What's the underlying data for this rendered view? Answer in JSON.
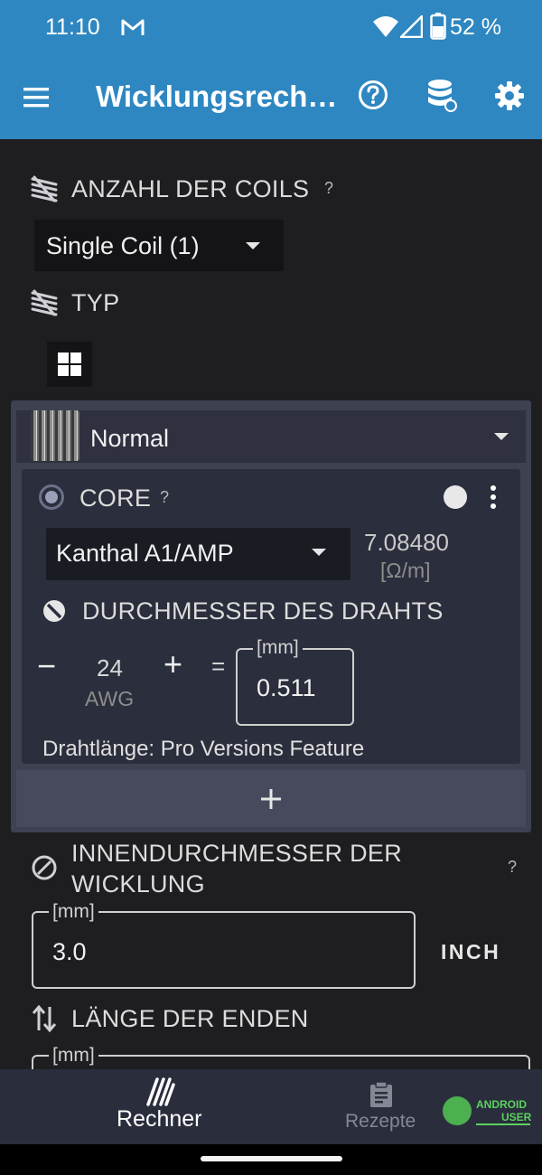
{
  "status_bar": {
    "time": "11:10",
    "battery": "52 %"
  },
  "app_bar": {
    "title": "Wicklungsrech…"
  },
  "coils_section": {
    "label": "ANZAHL DER COILS",
    "help": "?",
    "selected": "Single Coil (1)"
  },
  "type_section": {
    "label": "TYP"
  },
  "coil_card": {
    "wrap_type": "Normal",
    "core": {
      "label": "CORE",
      "help": "?",
      "material": "Kanthal A1/AMP",
      "resistance_value": "7.08480",
      "resistance_unit": "[Ω/m]"
    },
    "diameter": {
      "label": "DURCHMESSER DES DRAHTS",
      "minus": "−",
      "awg_value": "24",
      "awg_unit": "AWG",
      "plus": "+",
      "equals": "=",
      "mm_label": "[mm]",
      "mm_value": "0.511"
    },
    "wire_length_note": "Drahtlänge: Pro Versions Feature",
    "add": "+"
  },
  "inner_diameter": {
    "label_line1": "INNENDURCHMESSER DER",
    "label_line2": "WICKLUNG",
    "help": "?",
    "field_label": "[mm]",
    "value": "3.0",
    "unit_button": "INCH"
  },
  "leg_length": {
    "label": "LÄNGE DER ENDEN",
    "field_label": "[mm]"
  },
  "bottom_nav": {
    "tab_rechner": "Rechner",
    "tab_rezepte": "Rezepte"
  },
  "watermark": {
    "line1": "ANDROID",
    "line2": "USER"
  },
  "colors": {
    "app_bar": "#2e87c1",
    "background": "#1e1e21",
    "card": "#3e4152",
    "panel": "#2b2e3c",
    "nav": "#2a2d3c",
    "watermark_green": "#4caf50"
  }
}
